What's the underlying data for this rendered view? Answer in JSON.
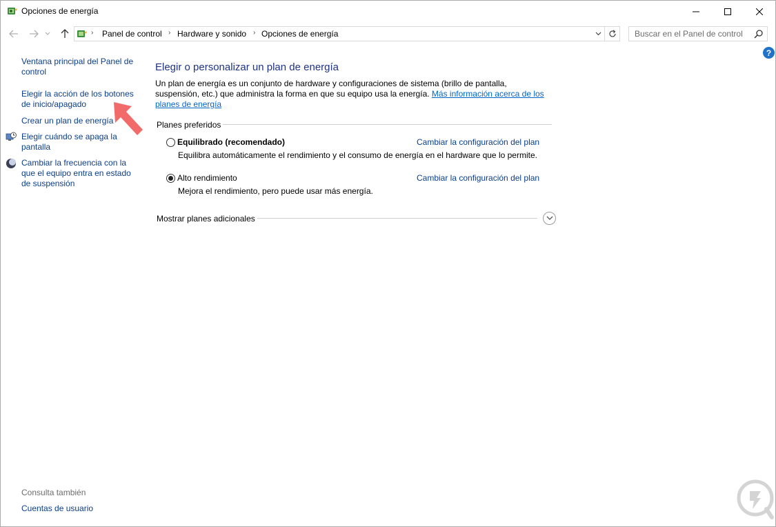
{
  "window": {
    "title": "Opciones de energía",
    "icon": "power-options-icon"
  },
  "controls": {
    "minimize_icon": "minimize-icon",
    "maximize_icon": "maximize-icon",
    "close_icon": "close-icon"
  },
  "address_bar": {
    "breadcrumbs": [
      "Panel de control",
      "Hardware y sonido",
      "Opciones de energía"
    ]
  },
  "search": {
    "placeholder": "Buscar en el Panel de control"
  },
  "sidebar": {
    "items": [
      {
        "label": "Ventana principal del Panel de control"
      },
      {
        "label": "Elegir la acción de los botones de inicio/apagado"
      },
      {
        "label": "Crear un plan de energía"
      },
      {
        "label": "Elegir cuándo se apaga la pantalla",
        "icon": "monitor-clock-icon"
      },
      {
        "label": "Cambiar la frecuencia con la que el equipo entra en estado de suspensión",
        "icon": "moon-icon"
      }
    ],
    "see_also": "Consulta también",
    "user_accounts": "Cuentas de usuario"
  },
  "main": {
    "title": "Elegir o personalizar un plan de energía",
    "description": "Un plan de energía es un conjunto de hardware y configuraciones de sistema (brillo de pantalla, suspensión, etc.) que administra la forma en que su equipo usa la energía.",
    "more_info_link": "Más información acerca de los planes de energía",
    "preferred_plans_label": "Planes preferidos",
    "plans": [
      {
        "name": "Equilibrado (recomendado)",
        "description": "Equilibra automáticamente el rendimiento y el consumo de energía en el hardware que lo permite.",
        "change_link": "Cambiar la configuración del plan",
        "selected": false
      },
      {
        "name": "Alto rendimiento",
        "description": "Mejora el rendimiento, pero puede usar más energía.",
        "change_link": "Cambiar la configuración del plan",
        "selected": true
      }
    ],
    "show_more_label": "Mostrar planes adicionales"
  },
  "colors": {
    "link": "#0a3e8c",
    "heading": "#1e3287",
    "help_badge": "#1e73c9",
    "annotation_arrow": "#f26b6b"
  }
}
